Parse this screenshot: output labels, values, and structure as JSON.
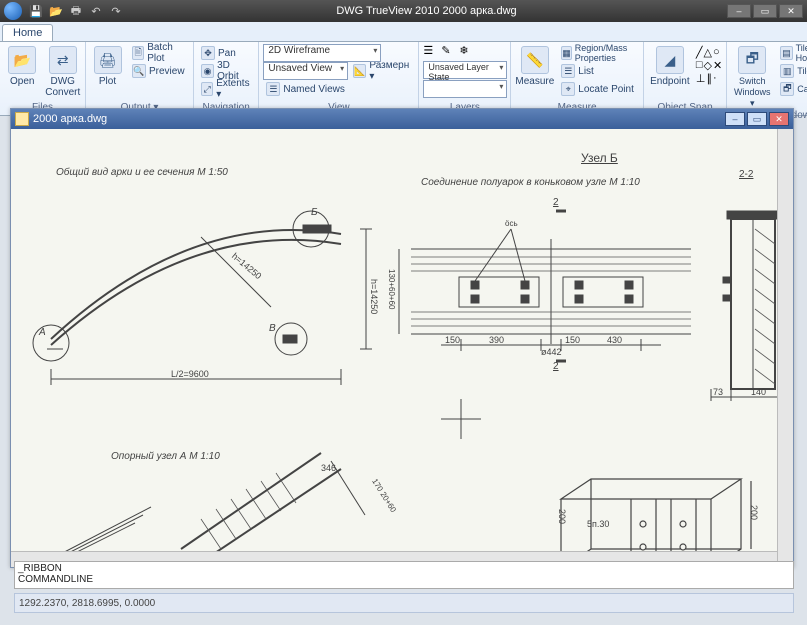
{
  "app": {
    "title": "DWG TrueView 2010     2000 арка.dwg",
    "tabs": [
      "Home"
    ]
  },
  "qat": [
    "save",
    "open",
    "print",
    "undo",
    "redo"
  ],
  "window_buttons": {
    "min": "–",
    "max": "▭",
    "close": "✕"
  },
  "ribbon": {
    "files": {
      "label": "Files",
      "open": "Open",
      "convert": "DWG Convert"
    },
    "output": {
      "label": "Output ▾",
      "plot": "Plot",
      "batch": "Batch Plot",
      "preview": "Preview"
    },
    "navigation": {
      "label": "Navigation",
      "pan": "Pan",
      "orbit": "3D Orbit",
      "extents": "Extents ▾"
    },
    "view": {
      "label": "View",
      "visualstyle": "2D Wireframe",
      "savedview": "Unsaved View",
      "namedviews": "Named Views",
      "dimstyle": "Размерн ▾"
    },
    "layers": {
      "label": "Layers",
      "layerstate": "Unsaved Layer State"
    },
    "measure": {
      "label": "Measure",
      "measure_btn": "Measure",
      "region": "Region/Mass Properties",
      "list": "List",
      "locate": "Locate Point"
    },
    "osnap": {
      "label": "Object Snap",
      "endpoint": "Endpoint"
    },
    "window": {
      "label": "Window",
      "switch": "Switch Windows ▾",
      "tileh": "Tile Horizontally",
      "tilev": "Tile Vertically",
      "cascade": "Cascade"
    }
  },
  "doc": {
    "title": "2000 арка.dwg",
    "wbtn": {
      "min": "–",
      "max": "▭",
      "close": "✕"
    }
  },
  "cmd": {
    "line1": "_RIBBON",
    "line2": "COMMANDLINE"
  },
  "status": {
    "coords": "1292.2370, 2818.6995, 0.0000"
  },
  "drawing": {
    "title_main": "Общий вид арки и ее сечения М 1:50",
    "node_b": "Узел Б",
    "conn": "Соединение полуарок в коньковом узле М 1:10",
    "sec22": "2-2",
    "support": "Опорный узел А    М 1:10",
    "dim_span": "L/2=9600",
    "dim_h": "h=14250",
    "mark_a": "А",
    "mark_b": "Б",
    "mark_v": "В",
    "sec2": "2",
    "dim_150": "150",
    "dim_390": "390",
    "dim_430": "430",
    "dim_phi": "ø442",
    "dim_130": "130+60+60",
    "dim_140": "140",
    "dim_200": "200",
    "dim_73": "73",
    "dim_fsya": "öсь",
    "dim_346": "346",
    "dim_170": "170 20+60",
    "dim_5n30": "5п.30"
  }
}
